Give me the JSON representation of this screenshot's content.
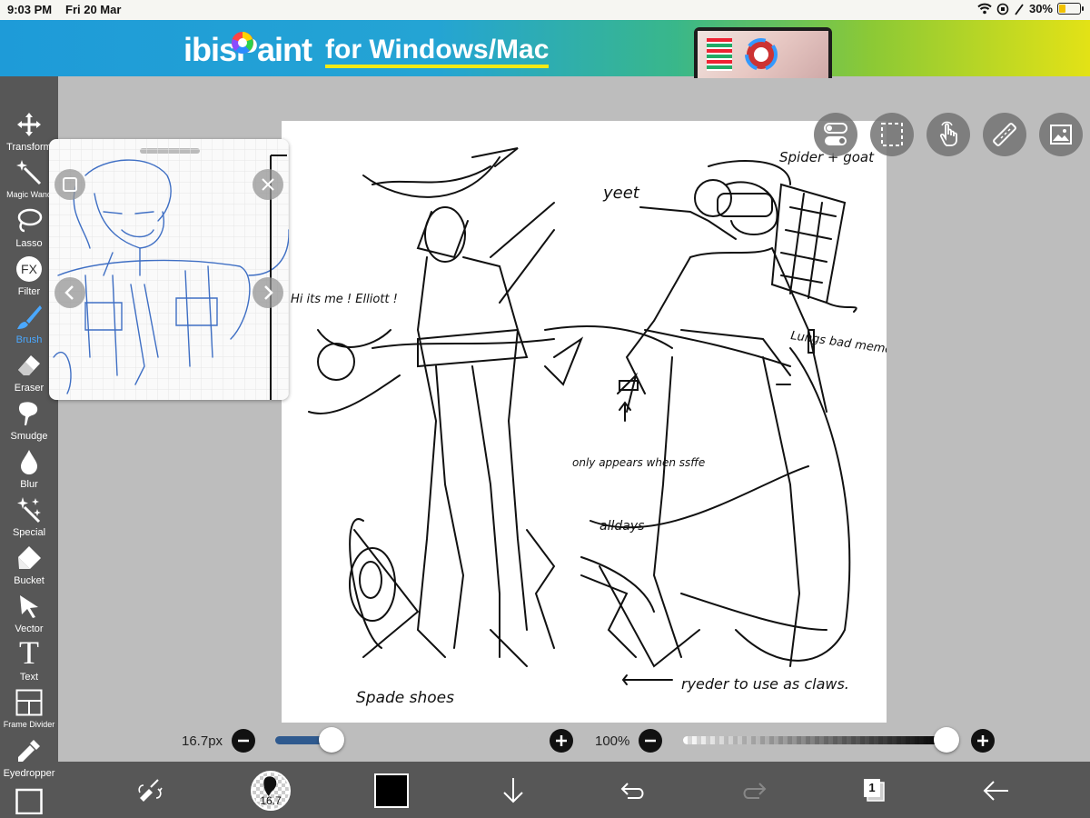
{
  "status_bar": {
    "time": "9:03 PM",
    "date": "Fri 20 Mar",
    "battery": "30%",
    "battery_level": 0.3
  },
  "banner": {
    "logo": "ibisPaint",
    "tagline": "for Windows/Mac"
  },
  "toolbar": {
    "tools": [
      {
        "label": "Transform",
        "icon": "move-arrows-icon"
      },
      {
        "label": "Magic Wand",
        "icon": "magic-wand-icon"
      },
      {
        "label": "Lasso",
        "icon": "lasso-icon"
      },
      {
        "label": "Filter",
        "icon": "fx-icon"
      },
      {
        "label": "Brush",
        "icon": "brush-icon"
      },
      {
        "label": "Eraser",
        "icon": "eraser-icon"
      },
      {
        "label": "Smudge",
        "icon": "smudge-icon"
      },
      {
        "label": "Blur",
        "icon": "blur-drop-icon"
      },
      {
        "label": "Special",
        "icon": "sparkle-icon"
      },
      {
        "label": "Bucket",
        "icon": "bucket-icon"
      },
      {
        "label": "Vector",
        "icon": "vector-arrow-icon"
      },
      {
        "label": "Text",
        "icon": "text-icon"
      },
      {
        "label": "Frame Divider",
        "icon": "frame-divider-icon"
      },
      {
        "label": "Eyedropper",
        "icon": "eyedropper-icon"
      }
    ],
    "active": "Brush"
  },
  "filter_icon_text": "FX",
  "text_icon_text": "T",
  "canvas": {
    "notes": {
      "hi": "Hi its me ! Elliott !",
      "yeet": "yeet",
      "spider": "Spider + goat",
      "memory": "Lungs bad memory due to Grandad",
      "only": "only appears when ssffe",
      "alldays": "alldays",
      "spade": "Spade shoes",
      "ryder": "ryeder to use as claws."
    }
  },
  "brush_size": {
    "label": "16.7px",
    "fraction": 0.22
  },
  "opacity": {
    "label": "100%",
    "fraction": 1.0
  },
  "bottom_bar": {
    "brush_badge": "16.7",
    "layer_count": "1",
    "color": "#000000"
  }
}
